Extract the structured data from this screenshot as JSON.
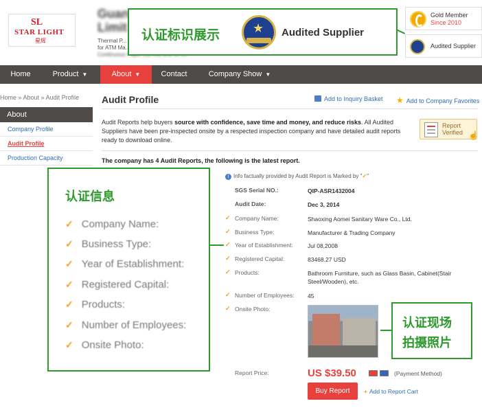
{
  "header": {
    "logo": {
      "mark": "SL",
      "name": "STAR LIGHT",
      "cn": "星辉"
    },
    "company_title_blurred": "Guan",
    "company_title_line2": "Limit",
    "company_sub_line1": "Thermal P...",
    "company_sub_line2": "for ATM Ma...",
    "company_sub_line3": "Continuous Paper (SL-09) and so on."
  },
  "callout_top": {
    "zh": "认证标识展示",
    "en": "Audited Supplier"
  },
  "membership": {
    "gold_label": "Gold Member",
    "gold_since": "Since 2010",
    "audited_label": "Audited Supplier"
  },
  "nav": {
    "items": [
      {
        "label": "Home"
      },
      {
        "label": "Product",
        "caret": "▼"
      },
      {
        "label": "About",
        "caret": "▼"
      },
      {
        "label": "Contact"
      },
      {
        "label": "Company Show",
        "caret": "▼"
      }
    ]
  },
  "breadcrumb": {
    "home": "Home",
    "sep1": " » ",
    "about": "About",
    "sep2": " » ",
    "current": "Audit Profile"
  },
  "sidebar": {
    "heading": "About",
    "items": [
      {
        "label": "Company Profile"
      },
      {
        "label": "Audit Profile"
      },
      {
        "label": "Production Capacity"
      }
    ]
  },
  "main": {
    "title": "Audit Profile",
    "add_basket": "Add to Inquiry Basket",
    "add_favorites": "Add to Company Favorites",
    "intro_pre": "Audit Reports help buyers ",
    "intro_bold": "source with confidence, save time and money, and reduce risks",
    "intro_post": ". All Audited Suppliers have been pre-inspected onsite by a respected inspection company and have detailed audit reports ready to download online.",
    "verified_l1": "Report",
    "verified_l2": "Verified",
    "latest_text": "The company has 4 Audit Reports, the following is the latest report.",
    "info_note_pre": "Info factually provided by Audit Report is Marked by \"",
    "info_note_check": "✓",
    "info_note_post": "\""
  },
  "report": {
    "serial_label": "SGS Serial NO.:",
    "serial_value": "QIP-ASR1432004",
    "date_label": "Audit Date:",
    "date_value": "Dec 3, 2014",
    "company_label": "Company Name:",
    "company_value": "Shaoxing Aomei Sanitary Ware Co., Ltd.",
    "btype_label": "Business Type:",
    "btype_value": "Manufacturer & Trading Company",
    "year_label": "Year of Establishment:",
    "year_value": "Jul 08,2008",
    "capital_label": "Registered Capital:",
    "capital_value": "83468.27 USD",
    "products_label": "Products:",
    "products_value": "Bathroom Furniture, such as Glass Basin, Cabinet(Stair Steel/Wooden), etc.",
    "employees_label": "Number of Employees:",
    "employees_value": "45",
    "photo_label": "Onsite Photo:",
    "check": "✓"
  },
  "purchase": {
    "price_label": "Report Price:",
    "price": "US $39.50",
    "payment": "(Payment Method)",
    "buy": "Buy Report",
    "cart_plus": "+",
    "cart": "Add to Report Cart"
  },
  "callout_left": {
    "zh": "认证信息",
    "items": [
      "Company Name:",
      "Business Type:",
      "Year of Establishment:",
      "Registered Capital:",
      "Products:",
      "Number of Employees:",
      "Onsite Photo:"
    ],
    "check": "✓"
  },
  "callout_right": {
    "zh1": "认证现场",
    "zh2": "拍摄照片"
  },
  "colors": {
    "accent_red": "#e8413d",
    "nav_dark": "#4e4a47",
    "callout_green": "#2e9a2e",
    "link_blue": "#2d6db5",
    "check_orange": "#f39a1e"
  }
}
